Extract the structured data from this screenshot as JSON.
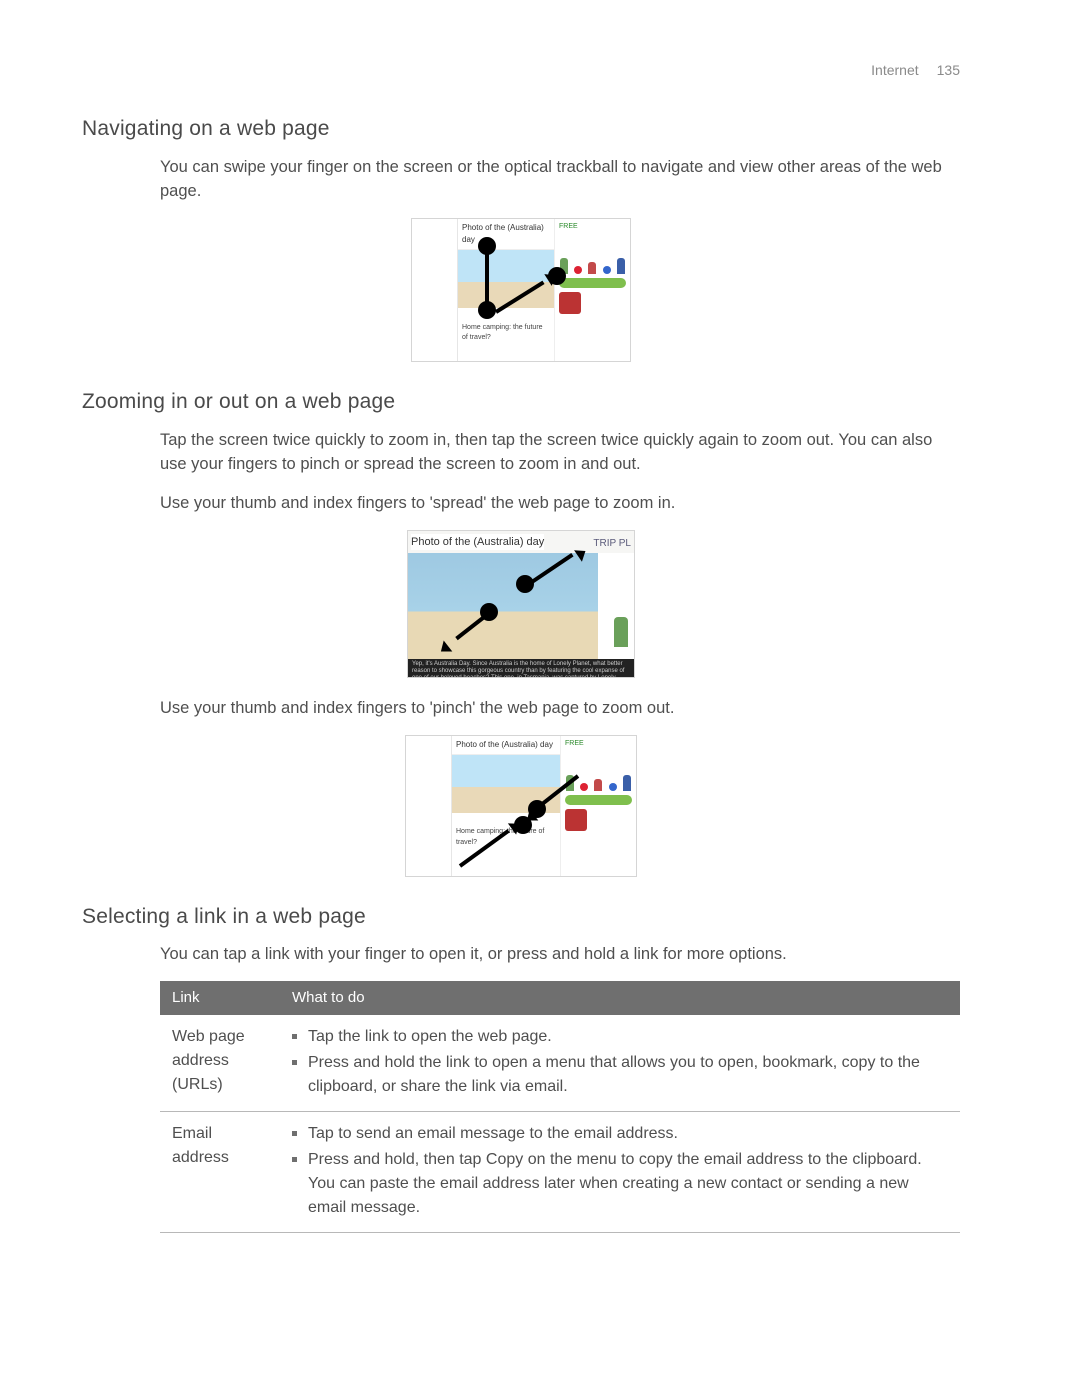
{
  "header": {
    "section": "Internet",
    "page_number": "135"
  },
  "sections": {
    "navigating": {
      "heading": "Navigating on a web page",
      "body": "You can swipe your finger on the screen or the optical trackball to navigate and view other areas of the web page.",
      "thumb": {
        "title": "Photo of the (Australia) day",
        "subtitle": "Home camping: the future of travel?",
        "right_header": "FREE"
      }
    },
    "zooming": {
      "heading": "Zooming in or out on a web page",
      "body1": "Tap the screen twice quickly to zoom in, then tap the screen twice quickly again to zoom out. You can also use your fingers to pinch or spread the screen to zoom in and out.",
      "body2": "Use your thumb and index fingers to 'spread' the web page to zoom in.",
      "zoom_fig": {
        "title": "Photo of the (Australia) day",
        "side": "TRIP PL",
        "footer": "Yep, it's Australia Day. Since Australia is the home of Lonely Planet, what better reason to showcase this gorgeous country than by featuring the cool expanse of one of our beloved beaches? This one, in Tasmania, was captured by Lonely"
      },
      "body3": "Use your thumb and index fingers to 'pinch' the web page to zoom out.",
      "pinch_thumb": {
        "title": "Photo of the (Australia) day",
        "subtitle": "Home camping: the future of travel?",
        "right_header": "FREE"
      }
    },
    "selecting": {
      "heading": "Selecting a link in a web page",
      "body": "You can tap a link with your finger to open it, or press and hold a link for more options.",
      "table": {
        "headers": {
          "col1": "Link",
          "col2": "What to do"
        },
        "rows": [
          {
            "label": "Web page address (URLs)",
            "items": [
              "Tap the link to open the web page.",
              "Press and hold the link to open a menu that allows you to open, bookmark, copy to the clipboard, or share the link via email."
            ]
          },
          {
            "label": "Email address",
            "items": [
              "Tap to send an email message to the email address.",
              "Press and hold, then tap Copy on the menu to copy the email address to the clipboard. You can paste the email address later when creating a new contact or sending a new email message."
            ]
          }
        ]
      }
    }
  }
}
